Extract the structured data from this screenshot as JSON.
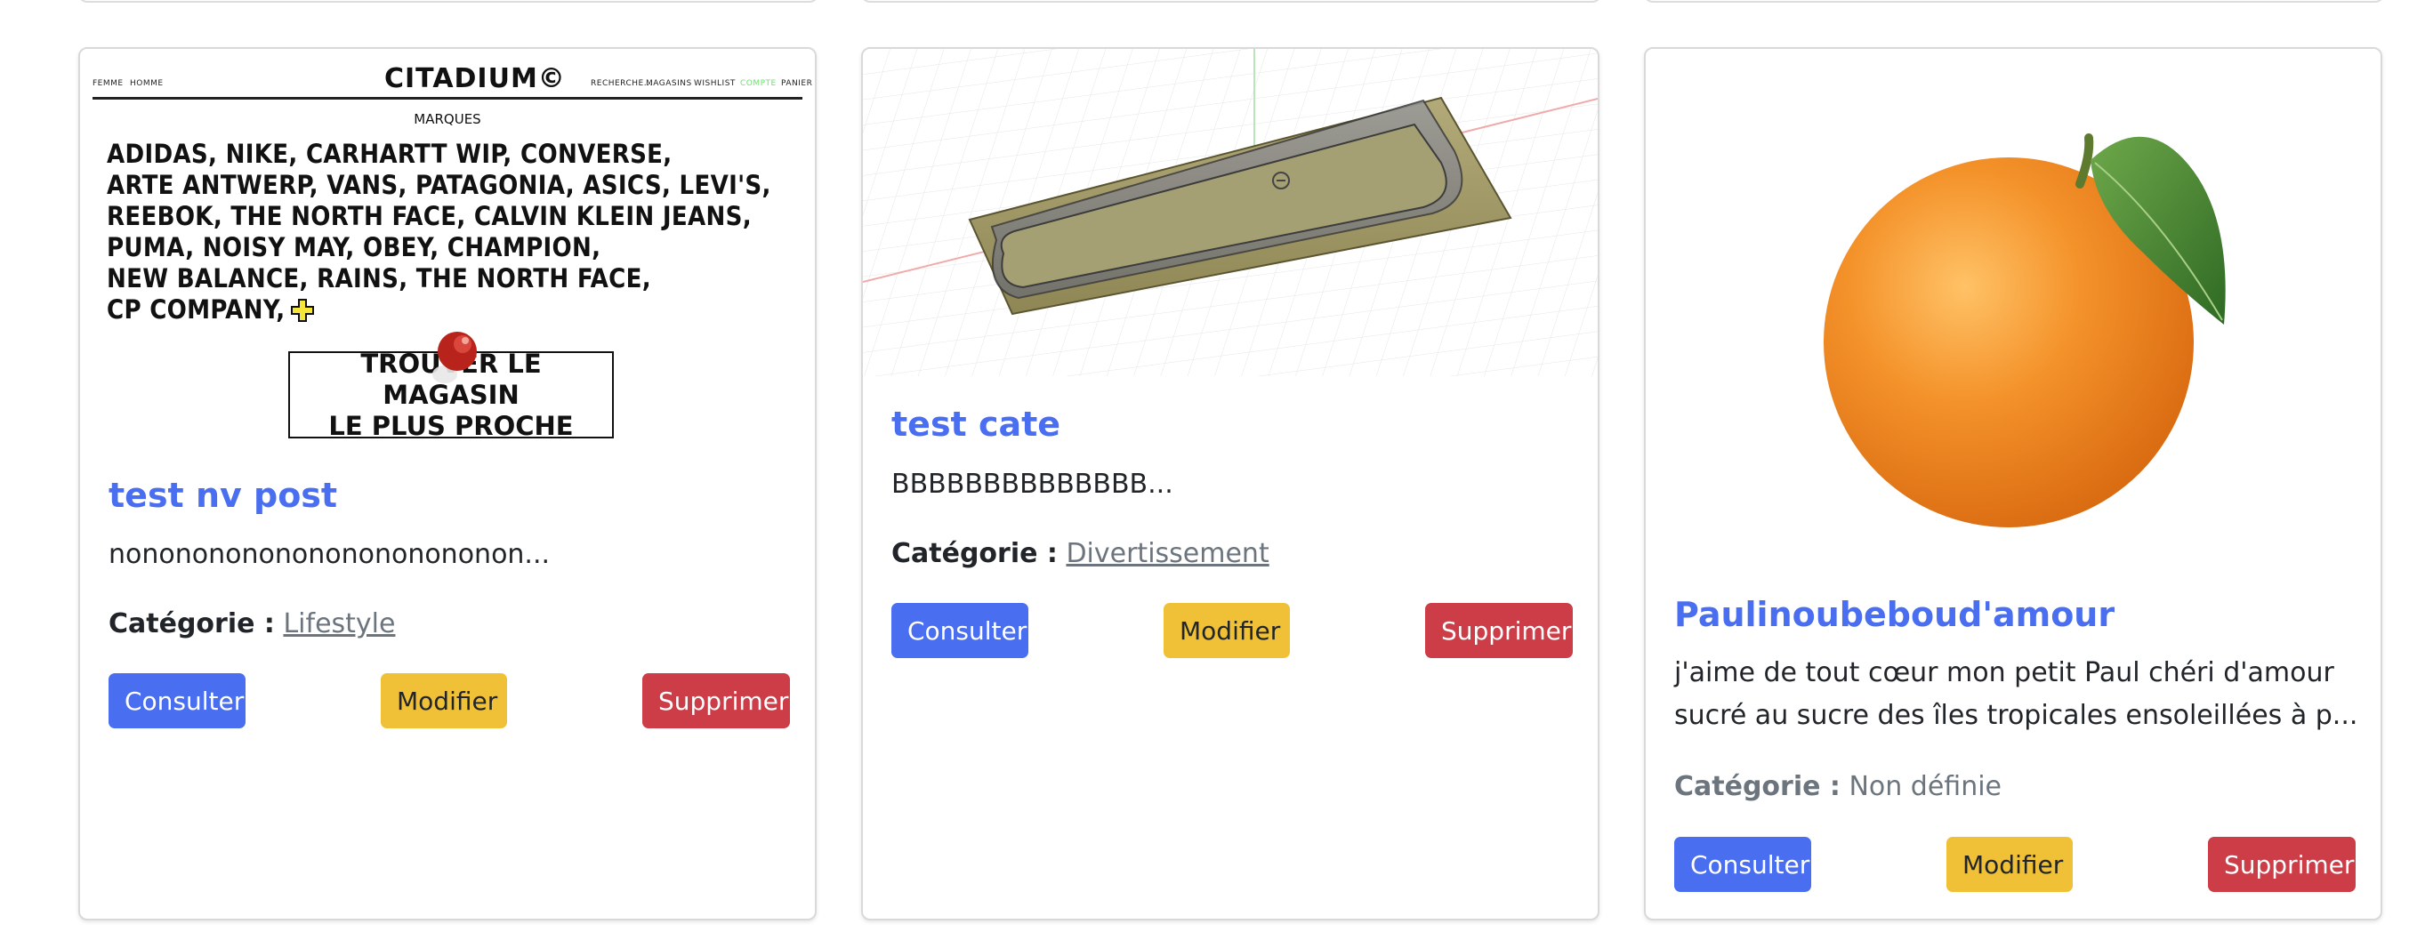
{
  "colors": {
    "primary": "#4a6ef0",
    "warning": "#f0c136",
    "danger": "#cc3d47",
    "muted": "#6c757d",
    "text": "#212529"
  },
  "cards": [
    {
      "image": {
        "kind": "website-screenshot",
        "nav_left": [
          "FEMME",
          "HOMME"
        ],
        "logo": "CITADIUM©",
        "nav_right": [
          "RECHERCHE...",
          "MAGASINS",
          "WISHLIST",
          "COMPTE",
          "PANIER"
        ],
        "heading": "MARQUES",
        "brand_lines": [
          "ADIDAS, NIKE, CARHARTT WIP, CONVERSE,",
          "ARTE ANTWERP, VANS, PATAGONIA, ASICS, LEVI'S,",
          "REEBOK, THE NORTH FACE, CALVIN KLEIN JEANS,",
          "PUMA, NOISY MAY, OBEY, CHAMPION,",
          "NEW BALANCE, RAINS, THE NORTH FACE,",
          "CP COMPANY,"
        ],
        "cta_lines": [
          "TROUVER LE MAGASIN",
          "LE PLUS PROCHE"
        ]
      },
      "title": "test nv post",
      "excerpt": "nonononononononononononon...",
      "category_label": "Catégorie :",
      "category": "Lifestyle",
      "buttons": {
        "view": "Consulter",
        "edit": "Modifier",
        "delete": "Supprimer"
      }
    },
    {
      "image": {
        "kind": "3d-model-render"
      },
      "title": "test cate",
      "excerpt": "BBBBBBBBBBBBBB...",
      "category_label": "Catégorie :",
      "category": "Divertissement",
      "buttons": {
        "view": "Consulter",
        "edit": "Modifier",
        "delete": "Supprimer"
      }
    },
    {
      "image": {
        "kind": "orange-photo"
      },
      "title": "Paulinoubeboud'amour",
      "excerpt_lines": [
        "j'aime de tout cœur mon petit Paul chéri d'amour",
        "sucré au sucre des îles tropicales ensoleillées à p..."
      ],
      "category_label": "Catégorie :",
      "category": "Non définie",
      "buttons": {
        "view": "Consulter",
        "edit": "Modifier",
        "delete": "Supprimer"
      }
    }
  ]
}
